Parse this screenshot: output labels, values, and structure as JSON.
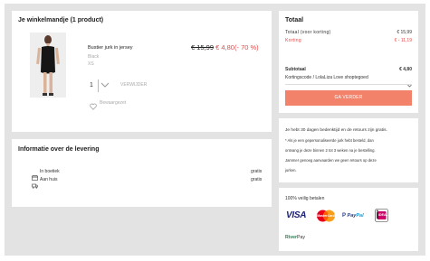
{
  "cart": {
    "title": "Je winkelmandje (1 product)",
    "item": {
      "name": "Bustier jurk in jersey",
      "color": "Black",
      "size": "XS",
      "old_price": "€ 15,99",
      "new_price": "€ 4,80",
      "discount": "(- 70 %)",
      "quantity": "1",
      "remove_label": "VERWIJDER",
      "save_label": "Bewaargezet"
    }
  },
  "delivery": {
    "title": "Informatie over de levering",
    "options": [
      {
        "label": "In boetiek",
        "price": "gratis",
        "icon": "shop-icon"
      },
      {
        "label": "Aan huis",
        "price": "gratis",
        "icon": "truck-icon"
      }
    ]
  },
  "totals": {
    "title": "Totaal",
    "total_label": "Totaal (voor korting)",
    "total_value": "€ 15,99",
    "discount_label": "Korting",
    "discount_value": "€ - 11,19",
    "subtotal_label": "Subtotaal",
    "subtotal_value": "€ 4,80",
    "voucher_label": "Kortingscode / LolaLiza Love shoptegoed",
    "checkout_label": "GA VERDER"
  },
  "returns": {
    "lines": [
      "Je hebt 30 dagen bedenktijd en de retours zijn gratis.",
      "* Als je een gepersonaliseerde jurk hebt besteld, dan",
      "ontvang je deze binnen 2 tot 3 weken na je bestelling.",
      "Jammer genoeg aanvaarden we geen retours op deze",
      "jurken."
    ]
  },
  "payment": {
    "title": "100% veilig betalen",
    "visa": "VISA",
    "mastercard": "MasterCard",
    "paypal_a": "Pay",
    "paypal_b": "Pal",
    "ideal": "iDEAL",
    "riverty_a": "River",
    "riverty_b": "Pay"
  },
  "colors": {
    "accent": "#f2826a",
    "discount_red": "#e24a4a",
    "background": "#e3e3e3"
  }
}
